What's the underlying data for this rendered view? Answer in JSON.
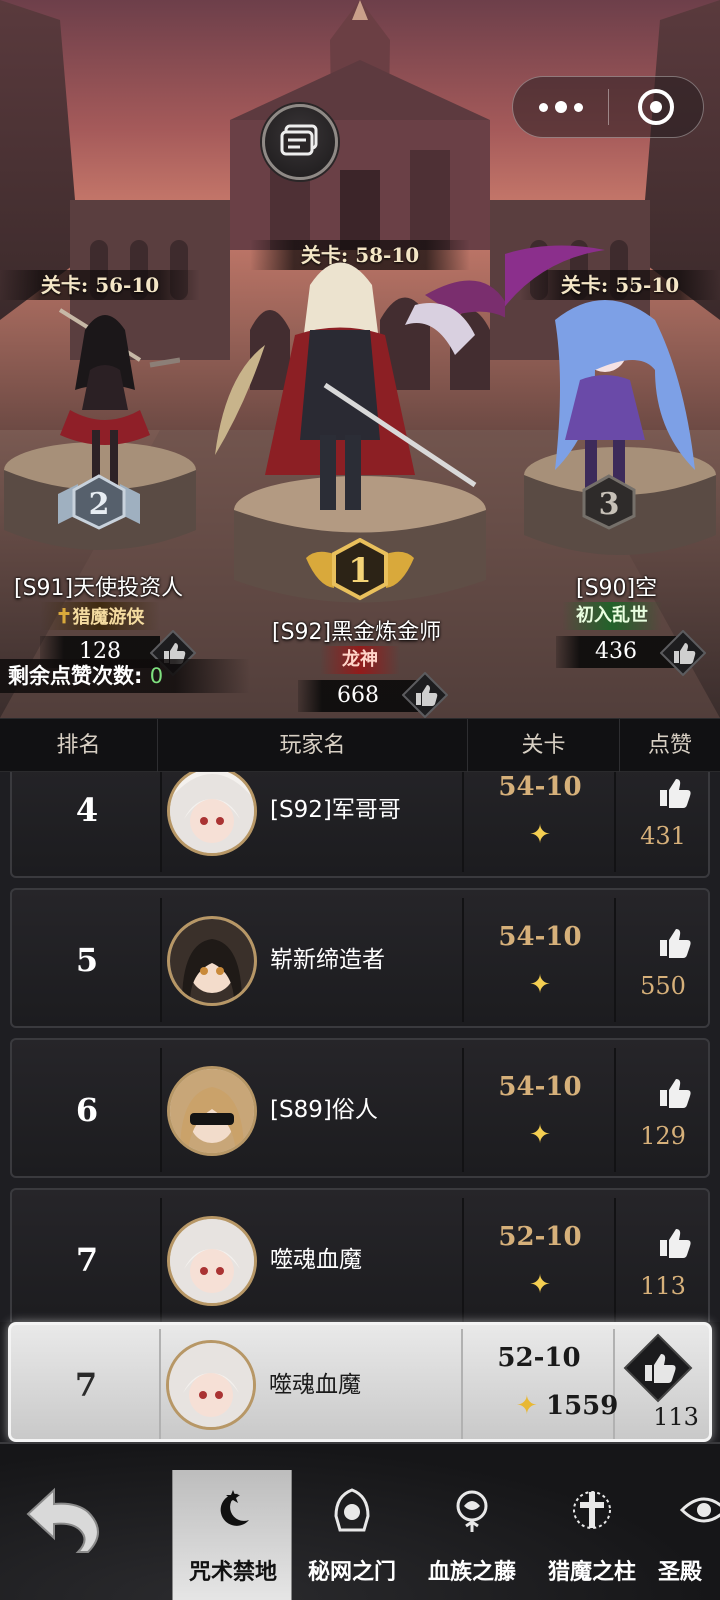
{
  "topbar": {
    "more_icon": "more-dots-icon",
    "close_icon": "target-close-icon"
  },
  "chat_icon": "chat-bubble-icon",
  "podium": {
    "first": {
      "rank": "1",
      "stage": "关卡: 58-10",
      "name": "[S92]黑金炼金师",
      "title": "龙神",
      "likes": "668"
    },
    "second": {
      "rank": "2",
      "stage": "关卡: 56-10",
      "name": "[S91]天使投资人",
      "title": "猎魔游侠",
      "likes": "128"
    },
    "third": {
      "rank": "3",
      "stage": "关卡: 55-10",
      "name": "[S90]空",
      "title": "初入乱世",
      "likes": "436"
    }
  },
  "remaining_likes": {
    "label": "剩余点赞次数:",
    "value": "0"
  },
  "table": {
    "headers": [
      "排名",
      "玩家名",
      "关卡",
      "点赞"
    ],
    "rows": [
      {
        "rank": "4",
        "name": "[S92]军哥哥",
        "stage": "54-10",
        "star": "✦",
        "likes": "431"
      },
      {
        "rank": "5",
        "name": "崭新缔造者",
        "stage": "54-10",
        "star": "✦",
        "likes": "550"
      },
      {
        "rank": "6",
        "name": "[S89]俗人",
        "stage": "54-10",
        "star": "✦",
        "likes": "129"
      },
      {
        "rank": "7",
        "name": "噬魂血魔",
        "stage": "52-10",
        "star": "✦",
        "likes": "113"
      }
    ]
  },
  "my_row": {
    "rank": "7",
    "name": "噬魂血魔",
    "stage": "52-10",
    "star": "✦",
    "score": "1559",
    "likes": "113"
  },
  "nav": {
    "back_icon": "back-arrow-icon",
    "tabs": [
      {
        "label": "咒术禁地",
        "icon": "moon-star-icon",
        "active": true
      },
      {
        "label": "秘网之门",
        "icon": "hooded-figure-icon",
        "active": false
      },
      {
        "label": "血族之藤",
        "icon": "rose-icon",
        "active": false
      },
      {
        "label": "猎魔之柱",
        "icon": "holy-cross-icon",
        "active": false
      },
      {
        "label": "圣殿",
        "icon": "eye-icon",
        "active": false
      }
    ]
  },
  "colors": {
    "accent_gold": "#d6b07a",
    "green_value": "#7fe07f",
    "star": "#f5cf52"
  }
}
